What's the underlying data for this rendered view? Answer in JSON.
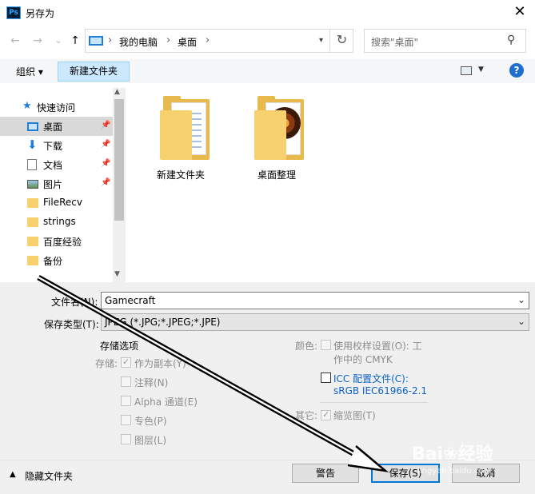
{
  "window": {
    "title": "另存为",
    "app_icon_text": "Ps",
    "close_glyph": "✕"
  },
  "nav": {
    "back_glyph": "←",
    "forward_glyph": "→",
    "dropdown_glyph": "⌄",
    "up_glyph": "↑",
    "breadcrumb": [
      "我的电脑",
      "桌面"
    ],
    "separator": "›",
    "search_placeholder": "搜索\"桌面\""
  },
  "toolbar": {
    "organize_label": "组织 ▾",
    "new_folder_label": "新建文件夹",
    "help_label": "?"
  },
  "sidebar": {
    "items": [
      {
        "label": "快速访问",
        "icon": "star-icon",
        "pinned": false,
        "selected": false
      },
      {
        "label": "桌面",
        "icon": "desktop-icon",
        "pinned": true,
        "selected": true
      },
      {
        "label": "下载",
        "icon": "download-icon",
        "pinned": true,
        "selected": false
      },
      {
        "label": "文档",
        "icon": "document-icon",
        "pinned": true,
        "selected": false
      },
      {
        "label": "图片",
        "icon": "picture-icon",
        "pinned": true,
        "selected": false
      },
      {
        "label": "FileRecv",
        "icon": "folder-icon",
        "pinned": false,
        "selected": false
      },
      {
        "label": "strings",
        "icon": "folder-icon",
        "pinned": false,
        "selected": false
      },
      {
        "label": "百度经验",
        "icon": "folder-icon",
        "pinned": false,
        "selected": false
      },
      {
        "label": "备份",
        "icon": "folder-icon",
        "pinned": false,
        "selected": false
      }
    ]
  },
  "files": [
    {
      "name": "新建文件夹",
      "icon": "folder-with-document-icon"
    },
    {
      "name": "桌面整理",
      "icon": "folder-with-image-icon"
    }
  ],
  "form": {
    "filename_label": "文件名(N):",
    "filename_value": "Gamecraft",
    "filetype_label": "保存类型(T):",
    "filetype_value": "JPEG (*.JPG;*.JPEG;*.JPE)",
    "storage_options_title": "存储选项",
    "storage_label": "存储:",
    "options": [
      {
        "label": "作为副本(Y)",
        "checked": true
      },
      {
        "label": "注释(N)",
        "checked": false
      },
      {
        "label": "Alpha 通道(E)",
        "checked": false
      },
      {
        "label": "专色(P)",
        "checked": false
      },
      {
        "label": "图层(L)",
        "checked": false
      }
    ],
    "color_label": "颜色:",
    "proof_setup_label_1": "使用校样设置(O):  工",
    "proof_setup_label_2": "作中的 CMYK",
    "icc_label_1": "ICC 配置文件(C):",
    "icc_label_2": "sRGB IEC61966-2.1",
    "other_label": "其它:",
    "thumbnail_label": "缩览图(T)",
    "thumbnail_checked": true
  },
  "footer": {
    "hide_folders_label": "隐藏文件夹",
    "warning_button": "警告",
    "save_button": "保存(S)",
    "cancel_button": "取消"
  },
  "colors": {
    "accent": "#0078d7",
    "selected_sidebar": "#d9d9d9",
    "new_folder_bg": "#cce8ff",
    "annotation_arrow": "#000000"
  }
}
